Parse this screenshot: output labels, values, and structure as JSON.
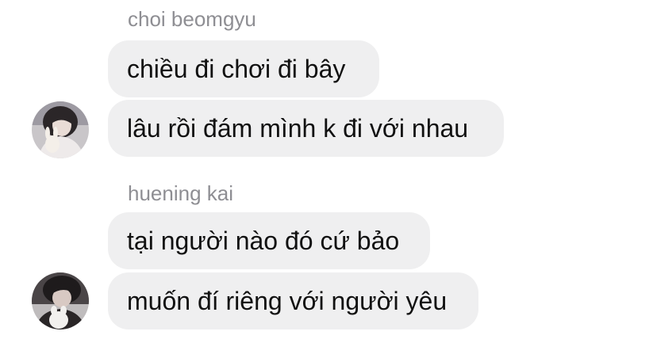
{
  "groups": [
    {
      "sender": "choi beomgyu",
      "messages": [
        "chiều đi chơi đi bây",
        "lâu rồi đám mình k đi với nhau"
      ],
      "avatar_icon": "user-avatar-photo"
    },
    {
      "sender": "huening kai",
      "messages": [
        "tại người nào đó cứ bảo",
        "muốn đí riêng với người yêu"
      ],
      "avatar_icon": "user-avatar-photo"
    }
  ],
  "colors": {
    "bubble": "#efeff0",
    "sender_name": "#8e8e93",
    "message_text": "#111111"
  }
}
